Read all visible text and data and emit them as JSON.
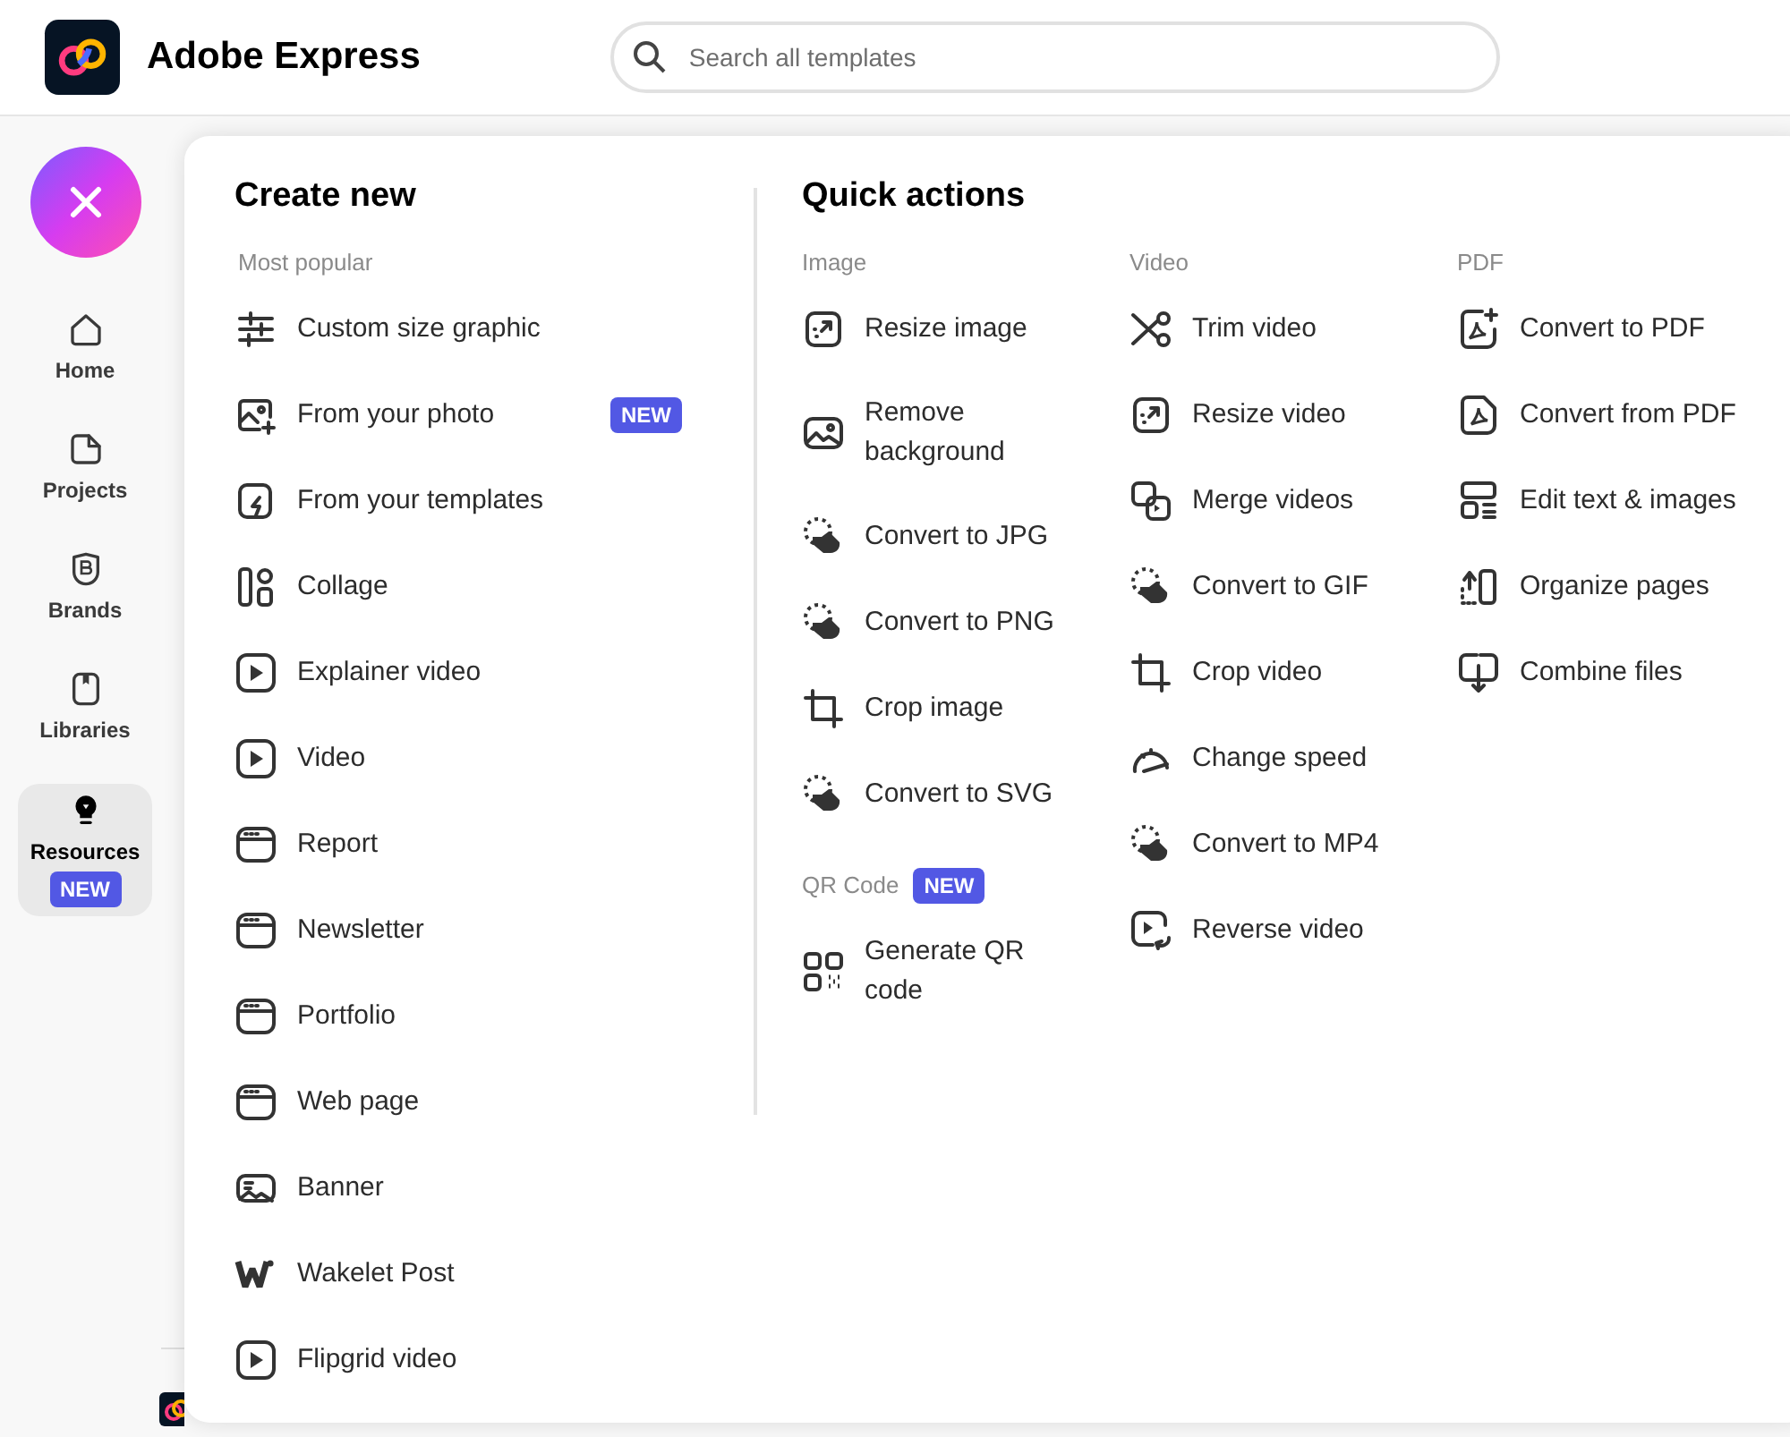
{
  "header": {
    "title": "Adobe Express",
    "search": {
      "placeholder": "Search all templates"
    }
  },
  "sidebar": {
    "items": [
      {
        "label": "Home",
        "selected": false
      },
      {
        "label": "Projects",
        "selected": false
      },
      {
        "label": "Brands",
        "selected": false
      },
      {
        "label": "Libraries",
        "selected": false
      },
      {
        "label": "Resources",
        "selected": true,
        "badge": "NEW"
      }
    ]
  },
  "create_new": {
    "title": "Create new",
    "section": "Most popular",
    "items": [
      {
        "label": "Custom size graphic"
      },
      {
        "label": "From your photo",
        "badge": "NEW"
      },
      {
        "label": "From your templates"
      },
      {
        "label": "Collage"
      },
      {
        "label": "Explainer video"
      },
      {
        "label": "Video"
      },
      {
        "label": "Report"
      },
      {
        "label": "Newsletter"
      },
      {
        "label": "Portfolio"
      },
      {
        "label": "Web page"
      },
      {
        "label": "Banner"
      },
      {
        "label": "Wakelet Post"
      },
      {
        "label": "Flipgrid video"
      }
    ]
  },
  "quick_actions": {
    "title": "Quick actions",
    "columns": [
      {
        "groups": [
          {
            "heading": "Image",
            "items": [
              {
                "label": "Resize image"
              },
              {
                "label": "Remove background"
              },
              {
                "label": "Convert to JPG"
              },
              {
                "label": "Convert to PNG"
              },
              {
                "label": "Crop image"
              },
              {
                "label": "Convert to SVG"
              }
            ]
          },
          {
            "heading": "QR Code",
            "badge": "NEW",
            "items": [
              {
                "label": "Generate QR code"
              }
            ]
          }
        ]
      },
      {
        "groups": [
          {
            "heading": "Video",
            "items": [
              {
                "label": "Trim video"
              },
              {
                "label": "Resize video"
              },
              {
                "label": "Merge videos"
              },
              {
                "label": "Convert to GIF"
              },
              {
                "label": "Crop video"
              },
              {
                "label": "Change speed"
              },
              {
                "label": "Convert to MP4"
              },
              {
                "label": "Reverse video"
              }
            ]
          }
        ]
      },
      {
        "groups": [
          {
            "heading": "PDF",
            "items": [
              {
                "label": "Convert to PDF"
              },
              {
                "label": "Convert from PDF"
              },
              {
                "label": "Edit text & images"
              },
              {
                "label": "Organize pages"
              },
              {
                "label": "Combine files"
              }
            ]
          }
        ]
      }
    ]
  }
}
